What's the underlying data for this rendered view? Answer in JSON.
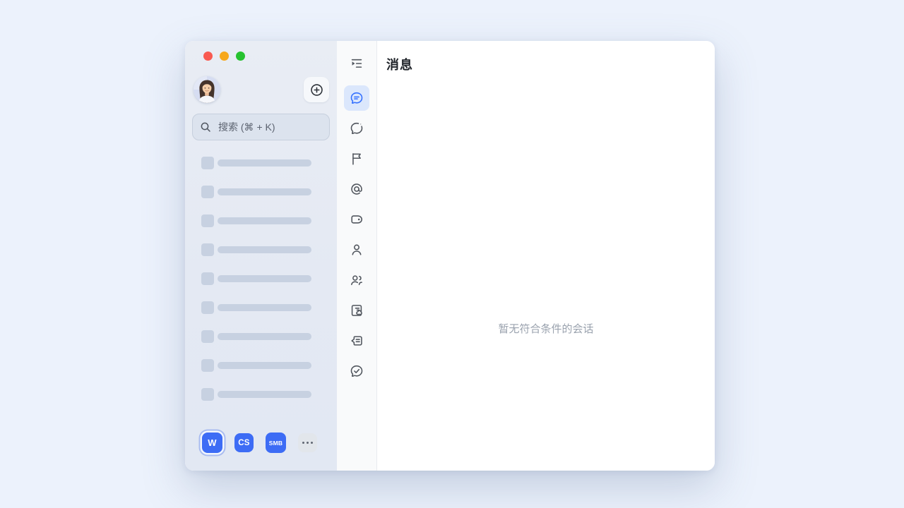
{
  "window": {
    "traffic_lights": [
      {
        "name": "close",
        "color": "#f95a50"
      },
      {
        "name": "minimize",
        "color": "#f7a81c"
      },
      {
        "name": "zoom",
        "color": "#27c22f"
      }
    ]
  },
  "sidebar": {
    "search": {
      "placeholder": "搜索 (⌘ + K)"
    },
    "skeleton_rows": 9,
    "workspaces": {
      "items": [
        {
          "label": "W",
          "active": true
        },
        {
          "label": "CS",
          "active": false
        },
        {
          "label": "SMB",
          "active": false
        }
      ]
    }
  },
  "nav_rail": {
    "items": [
      {
        "name": "collapse-sidebar",
        "active": false
      },
      {
        "name": "messages",
        "active": true
      },
      {
        "name": "moments",
        "active": false
      },
      {
        "name": "flagged",
        "active": false
      },
      {
        "name": "mentions",
        "active": false
      },
      {
        "name": "labels",
        "active": false
      },
      {
        "name": "contacts",
        "active": false
      },
      {
        "name": "groups",
        "active": false
      },
      {
        "name": "docs",
        "active": false
      },
      {
        "name": "topics",
        "active": false
      },
      {
        "name": "tasks",
        "active": false
      }
    ]
  },
  "main": {
    "title": "消息",
    "empty_text": "暂无符合条件的会话"
  },
  "colors": {
    "accent_blue": "#3370ff",
    "active_icon_bg": "#dbe7fc",
    "workspace_blue": "#3d6cf5",
    "skeleton": "#c7d1e1",
    "search_bg": "#dce3ee",
    "left_panel_bg": "#e5eaf3",
    "rail_bg": "#f9fafb",
    "page_bg": "#ecf2fc",
    "empty_text_color": "#9aa2ae"
  }
}
